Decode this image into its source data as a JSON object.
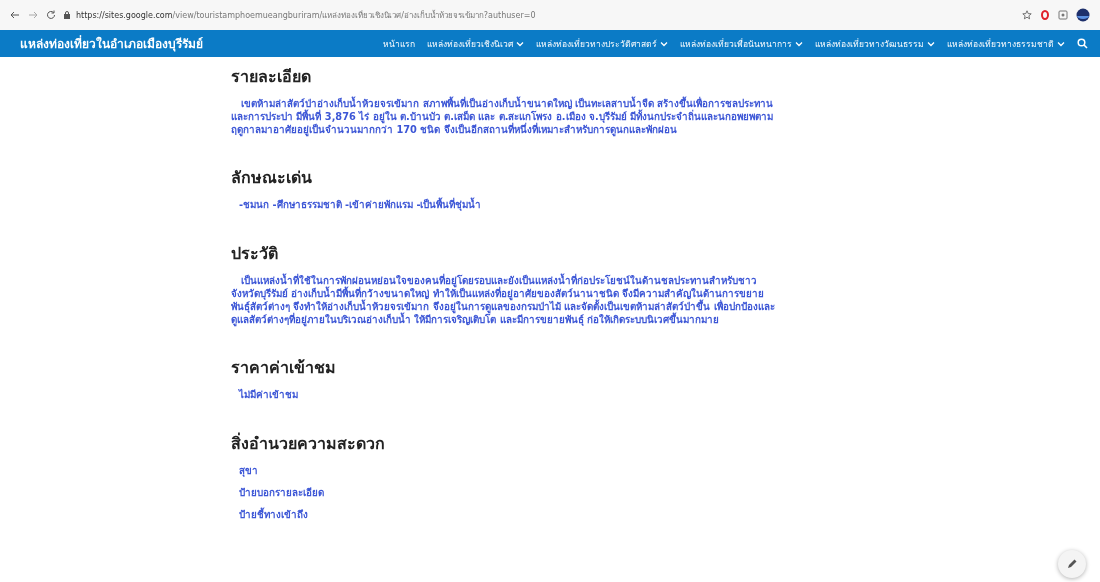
{
  "browser": {
    "url_host": "https://sites.google.com",
    "url_path": "/view/touristamphoemueangburiram/แหล่งท่องเที่ยวเชิงนิเวศ/อ่างเก็บน้ำห้วยจรเข้มาก?authuser=0"
  },
  "site": {
    "title": "แหล่งท่องเที่ยวในอำเภอเมืองบุรีรัมย์",
    "nav": [
      {
        "label": "หน้าแรก",
        "dropdown": false
      },
      {
        "label": "แหล่งท่องเที่ยวเชิงนิเวศ",
        "dropdown": true
      },
      {
        "label": "แหล่งท่องเที่ยวทางประวัติศาสตร์",
        "dropdown": true
      },
      {
        "label": "แหล่งท่องเที่ยวเพื่อนันทนาการ",
        "dropdown": true
      },
      {
        "label": "แหล่งท่องเที่ยวทางวัฒนธรรม",
        "dropdown": true
      },
      {
        "label": "แหล่งท่องเที่ยวทางธรรมชาติ",
        "dropdown": true
      }
    ]
  },
  "sections": [
    {
      "heading": "รายละเอียด",
      "kind": "paragraph",
      "lines": [
        "เขตห้ามล่าสัตว์ป่าอ่างเก็บน้ำห้วยจรเข้มาก สภาพพื้นที่เป็นอ่างเก็บน้ำขนาดใหญ่ เป็นทะเลสาบน้ำจืด สร้างขึ้นเพื่อการชลประทาน",
        "และการประปา มีพื้นที่ 3,876 ไร่ อยู่ใน ต.บ้านบัว ต.เสม็ด และ ต.สะแกโพรง อ.เมือง จ.บุรีรัมย์ มีทั้งนกประจำถิ่นและนกอพยพตาม",
        "ฤดูกาลมาอาศัยอยู่เป็นจำนวนมากกว่า 170 ชนิด จึงเป็นอีกสถานที่หนึ่งที่เหมาะสำหรับการดูนกและพักผ่อน"
      ]
    },
    {
      "heading": "ลักษณะเด่น",
      "kind": "list",
      "items": [
        "-ชมนก -ศึกษาธรรมชาติ -เข้าค่ายพักแรม -เป็นพื้นที่ชุ่มน้ำ"
      ]
    },
    {
      "heading": "ประวัติ",
      "kind": "paragraph",
      "lines": [
        "เป็นแหล่งน้ำที่ใช้ในการพักผ่อนหย่อนใจของคนที่อยู่โดยรอบและยังเป็นแหล่งน้ำที่ก่อประโยชน์ในด้านชลประทานสำหรับชาว",
        "จังหวัดบุรีรัมย์ อ่างเก็บน้ำมีพื้นที่กว้างขนาดใหญ่ ทำให้เป็นแหล่งที่อยู่อาศัยของสัตว์นานาชนิด จึงมีความสำคัญในด้านการขยาย",
        "พันธุ์สัตว์ต่างๆ จึงทำให้อ่างเก็บน้ำห้วยจรเข้มาก จึงอยู่ในการดูแลของกรมป่าไม้ และจัดตั้งเป็นเขตห้ามล่าสัตว์ป่าขึ้น เพื่อปกป้องและ",
        "ดูแลสัตว์ต่างๆที่อยู่ภายในบริเวณอ่างเก็บน้ำ ให้มีการเจริญเติบโต และมีการขยายพันธุ์ ก่อให้เกิดระบบนิเวศขึ้นมากมาย"
      ]
    },
    {
      "heading": "ราคาค่าเข้าชม",
      "kind": "list",
      "items": [
        "ไม่มีค่าเข้าชม"
      ]
    },
    {
      "heading": "สิ่งอำนวยความสะดวก",
      "kind": "list",
      "items": [
        "สุขา",
        "ป้ายบอกรายละเอียด",
        "ป้ายชี้ทางเข้าถึง"
      ]
    }
  ]
}
